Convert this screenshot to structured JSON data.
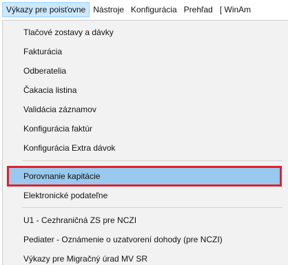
{
  "menubar": {
    "items": [
      {
        "label": "Výkazy pre poisťovne"
      },
      {
        "label": "Nástroje"
      },
      {
        "label": "Konfigurácia"
      },
      {
        "label": "Prehľad"
      },
      {
        "label": "[ WinAm"
      }
    ]
  },
  "dropdown": {
    "items": [
      {
        "label": "Tlačové zostavy a dávky"
      },
      {
        "label": "Fakturácia"
      },
      {
        "label": "Odberatelia"
      },
      {
        "label": "Čakacia listina"
      },
      {
        "label": "Validácia záznamov"
      },
      {
        "label": "Konfigurácia faktúr"
      },
      {
        "label": "Konfigurácia Extra dávok"
      },
      {
        "label": "Porovnanie kapitácie"
      },
      {
        "label": "Elektronické podateľne"
      },
      {
        "label": "U1 - Cezhraničná ZS pre NCZI"
      },
      {
        "label": "Pediater - Oznámenie o uzatvorení dohody (pre NCZI)"
      },
      {
        "label": "Výkazy pre Migračný úrad MV SR"
      }
    ]
  },
  "colors": {
    "highlight": "#99c9ef",
    "highlight_border": "#e0202a"
  }
}
